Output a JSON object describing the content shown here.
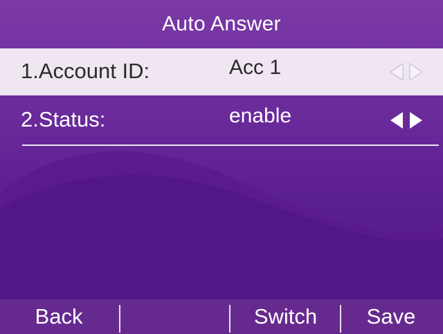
{
  "title": "Auto Answer",
  "rows": [
    {
      "label": "1.Account ID:",
      "value": "Acc 1",
      "selected": true
    },
    {
      "label": "2.Status:",
      "value": "enable",
      "selected": false
    }
  ],
  "softkeys": [
    "Back",
    "",
    "Switch",
    "Save"
  ],
  "colors": {
    "background": "#6a2a9a",
    "selected_row": "#efe6f1",
    "text": "#ffffff",
    "selected_text": "#2a2a2a"
  },
  "icons": {
    "selector_arrows": "left-right-arrows-icon"
  }
}
